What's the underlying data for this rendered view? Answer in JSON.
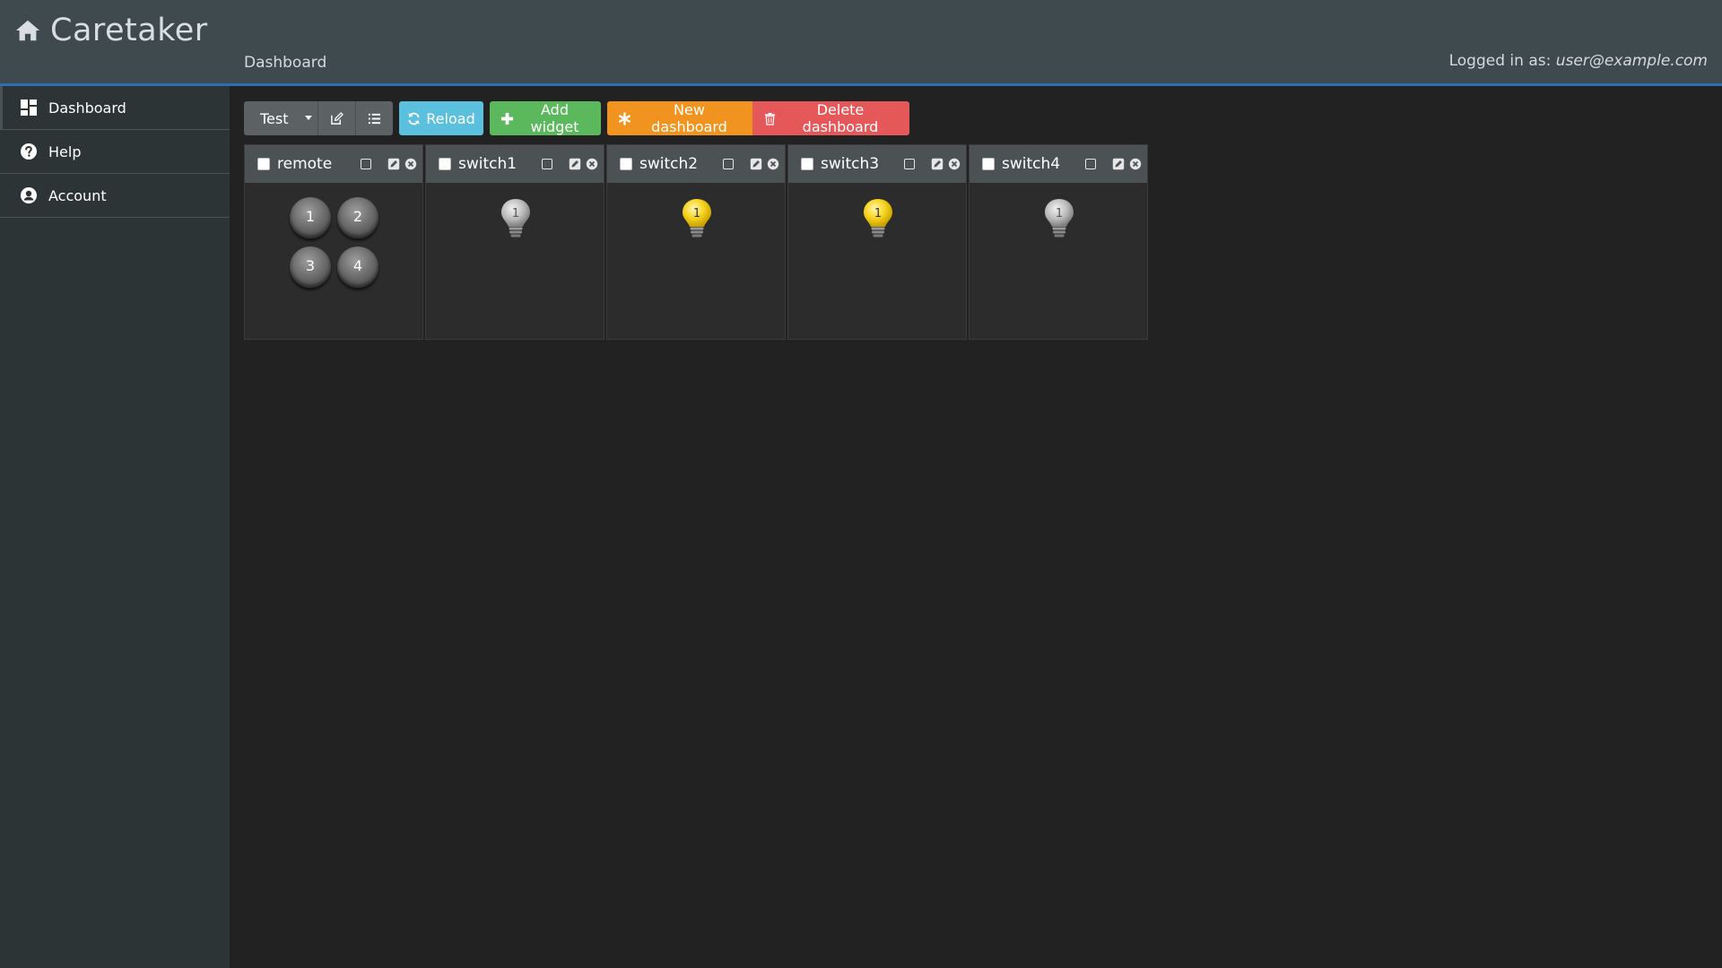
{
  "header": {
    "app_title": "Caretaker",
    "breadcrumb": "Dashboard",
    "login_prefix": "Logged in as: ",
    "login_user": "user@example.com"
  },
  "sidebar": {
    "items": [
      {
        "label": "Dashboard",
        "icon": "dashboard-icon",
        "active": true
      },
      {
        "label": "Help",
        "icon": "help-icon",
        "active": false
      },
      {
        "label": "Account",
        "icon": "account-icon",
        "active": false
      }
    ]
  },
  "toolbar": {
    "dashboard_select": "Test",
    "reload_label": "Reload",
    "add_widget_label": "Add widget",
    "new_dashboard_label": "New dashboard",
    "delete_dashboard_label": "Delete dashboard"
  },
  "widgets": [
    {
      "title": "remote",
      "type": "remote",
      "buttons": [
        "1",
        "2",
        "3",
        "4"
      ]
    },
    {
      "title": "switch1",
      "type": "switch",
      "state": "off",
      "label": "1"
    },
    {
      "title": "switch2",
      "type": "switch",
      "state": "on",
      "label": "1"
    },
    {
      "title": "switch3",
      "type": "switch",
      "state": "on",
      "label": "1"
    },
    {
      "title": "switch4",
      "type": "switch",
      "state": "off",
      "label": "1"
    }
  ],
  "colors": {
    "header_bg": "#3e4a4d",
    "sidebar_bg": "#2d3435",
    "accent_line": "#2f6db5",
    "reload": "#5bc0de",
    "add": "#5cb85c",
    "new": "#f0941f",
    "delete": "#e5585a",
    "bulb_on": "#f7d21c",
    "bulb_off": "#b9b9b9"
  }
}
